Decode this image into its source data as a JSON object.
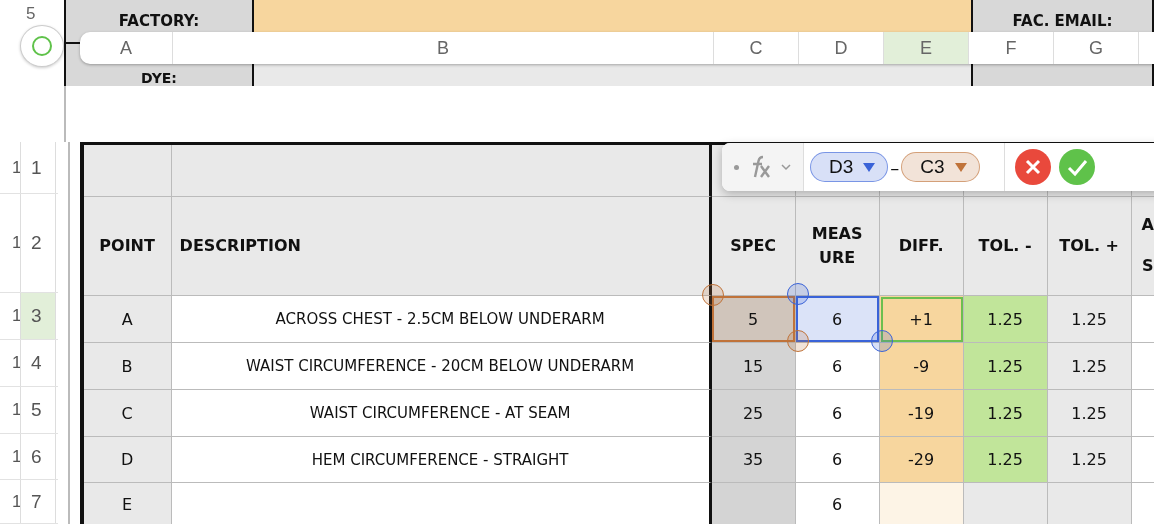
{
  "top_rows": [
    {
      "label": "5"
    }
  ],
  "top_fields": [
    {
      "label": "FACTORY:"
    },
    {
      "label": "FAC. EMAIL:"
    },
    {
      "label": "DYE:"
    }
  ],
  "column_letters": [
    {
      "label": "A",
      "selected": false
    },
    {
      "label": "B",
      "selected": false
    },
    {
      "label": "C",
      "selected": false
    },
    {
      "label": "D",
      "selected": false
    },
    {
      "label": "E",
      "selected": true
    },
    {
      "label": "F",
      "selected": false
    },
    {
      "label": "G",
      "selected": false
    }
  ],
  "formula": {
    "tokens": [
      {
        "label": "D3",
        "color": "#3a63d8"
      },
      {
        "label": "C3",
        "color": "#c0733a"
      }
    ],
    "operator": "–"
  },
  "row_numbers": [
    {
      "label": "1",
      "behind": "1",
      "selected": false
    },
    {
      "label": "2",
      "behind": "1",
      "selected": false
    },
    {
      "label": "3",
      "behind": "1",
      "selected": true
    },
    {
      "label": "4",
      "behind": "1",
      "selected": false
    },
    {
      "label": "5",
      "behind": "1",
      "selected": false
    },
    {
      "label": "6",
      "behind": "1",
      "selected": false
    },
    {
      "label": "7",
      "behind": "1",
      "selected": false
    }
  ],
  "table": {
    "columns": [
      "POINT",
      "DESCRIPTION",
      "SPEC",
      "MEAS\nURE",
      "DIFF.",
      "TOL. -",
      "TOL. +",
      "A\n\nS"
    ],
    "rows": [
      {
        "point": "A",
        "description": "ACROSS CHEST - 2.5CM BELOW UNDERARM",
        "spec": "5",
        "measure": "6",
        "diff": "+1",
        "tol_minus": "1.25",
        "tol_plus": "1.25",
        "selected": true
      },
      {
        "point": "B",
        "description": "WAIST CIRCUMFERENCE - 20CM BELOW UNDERARM",
        "spec": "15",
        "measure": "6",
        "diff": "-9",
        "tol_minus": "1.25",
        "tol_plus": "1.25",
        "selected": false
      },
      {
        "point": "C",
        "description": "WAIST CIRCUMFERENCE - AT SEAM",
        "spec": "25",
        "measure": "6",
        "diff": "-19",
        "tol_minus": "1.25",
        "tol_plus": "1.25",
        "selected": false
      },
      {
        "point": "D",
        "description": "HEM CIRCUMFERENCE - STRAIGHT",
        "spec": "35",
        "measure": "6",
        "diff": "-29",
        "tol_minus": "1.25",
        "tol_plus": "1.25",
        "selected": false
      },
      {
        "point": "E",
        "measure": "6",
        "selected": false
      }
    ]
  }
}
